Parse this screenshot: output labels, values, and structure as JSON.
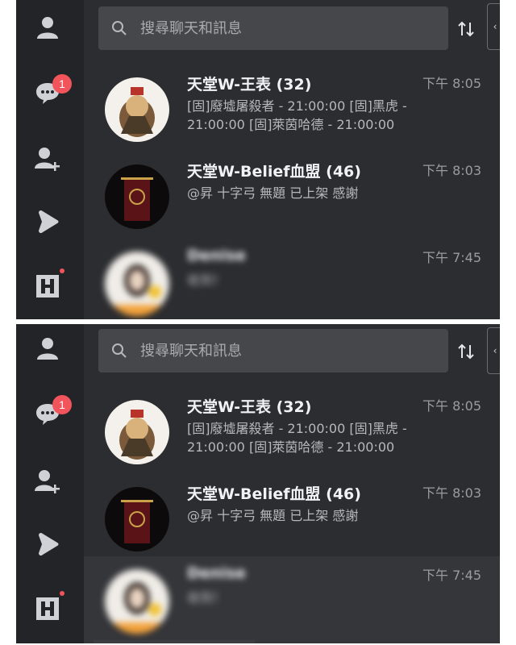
{
  "search": {
    "placeholder": "搜尋聊天和訊息"
  },
  "rail": {
    "items": [
      {
        "icon": "person-icon"
      },
      {
        "icon": "chat-icon",
        "badge": "1"
      },
      {
        "icon": "add-friend-icon"
      },
      {
        "icon": "play-arrow-icon"
      },
      {
        "icon": "h-logo-icon",
        "dot": true
      }
    ]
  },
  "chats": [
    {
      "name": "天堂W-王表 (32)",
      "time": "下午 8:05",
      "preview": "[固]廢墟屠殺者 - 21:00:00 [固]黑虎 - 21:00:00 [固]萊茵哈德 - 21:00:00",
      "avatar": "monster-avatar-icon"
    },
    {
      "name": "天堂W-Belief血盟 (46)",
      "time": "下午 8:03",
      "preview": "@昇 十字弓 無題 已上架 感謝",
      "avatar": "belief-banner-avatar-icon"
    },
    {
      "name": "Denise",
      "time": "下午 7:45",
      "preview": "收到！",
      "avatar": "blurred-person-avatar-icon"
    }
  ],
  "colors": {
    "rail_bg": "#232427",
    "panel_bg": "#2c2d30",
    "search_bg": "#45474b",
    "badge": "#f2545b",
    "hover_row": "#35363a"
  }
}
